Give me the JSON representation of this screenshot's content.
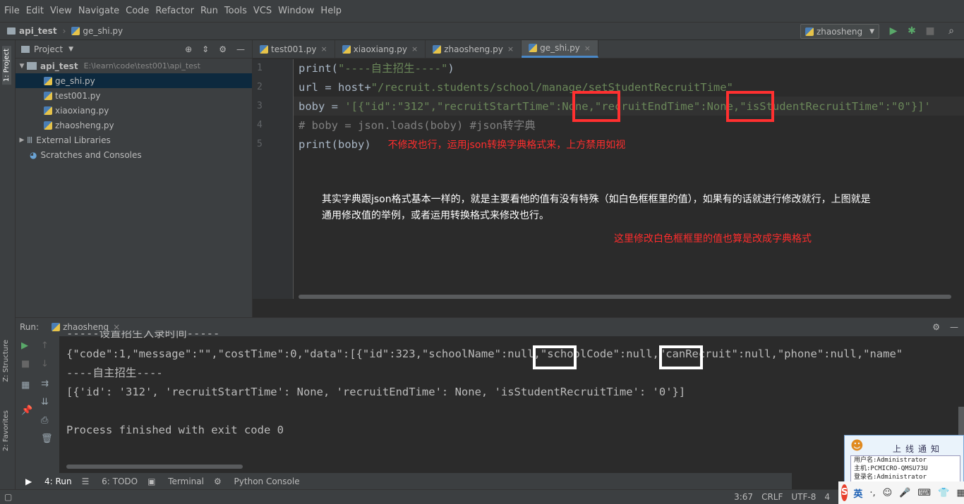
{
  "menu": [
    "File",
    "Edit",
    "View",
    "Navigate",
    "Code",
    "Refactor",
    "Run",
    "Tools",
    "VCS",
    "Window",
    "Help"
  ],
  "breadcrumb": {
    "project": "api_test",
    "file": "ge_shi.py"
  },
  "run_config": "zhaosheng",
  "project_panel": {
    "title": "Project",
    "root": {
      "name": "api_test",
      "path": "E:\\learn\\code\\test001\\api_test"
    },
    "files": [
      "ge_shi.py",
      "test001.py",
      "xiaoxiang.py",
      "zhaosheng.py"
    ],
    "external": "External Libraries",
    "scratches": "Scratches and Consoles"
  },
  "left_tabs": {
    "project": "1: Project",
    "structure": "Z: Structure",
    "favorites": "2: Favorites"
  },
  "editor_tabs": [
    "test001.py",
    "xiaoxiang.py",
    "zhaosheng.py",
    "ge_shi.py"
  ],
  "line_numbers": [
    "1",
    "2",
    "3",
    "4",
    "5"
  ],
  "code": {
    "l1_fn": "print(",
    "l1_str": "\"----自主招生----\"",
    "l1_end": ")",
    "l2_a": "url = host+",
    "l2_str": "\"/recruit.students/school/manage/setStudentRecruitTime\"",
    "l3_a": "boby = ",
    "l3_str": "'[{\"id\":\"312\",\"recruitStartTime\":None,\"recruitEndTime\":None,\"isStudentRecruitTime\":\"0\"}]'",
    "l4": "# boby = json.loads(boby) #json转字典",
    "l5": "print(boby)"
  },
  "annotations": {
    "inline": "不修改也行，运用json转换字典格式来，上方禁用如视",
    "para1": "其实字典跟json格式基本一样的，就是主要看他的值有没有特殊（如白色框框里的值），如果有的话就进行修改就行，上图就是",
    "para2": "通用修改值的举例，或者运用转换格式来修改也行。",
    "red_note": "这里修改白色框框里的值也算是改成字典格式"
  },
  "run_panel": {
    "label": "Run:",
    "config": "zhaosheng",
    "lines": [
      "-----设置招生入录时间-----",
      "{\"code\":1,\"message\":\"\",\"costTime\":0,\"data\":[{\"id\":323,\"schoolName\":null,\"schoolCode\":null,\"canRecruit\":null,\"phone\":null,\"name\"",
      "----自主招生----",
      "[{'id': '312', 'recruitStartTime': None, 'recruitEndTime': None, 'isStudentRecruitTime': '0'}]",
      "",
      "Process finished with exit code 0"
    ]
  },
  "bottom_tabs": [
    "4: Run",
    "6: TODO",
    "Terminal",
    "Python Console"
  ],
  "status": {
    "position": "3:67",
    "line_sep": "CRLF",
    "encoding": "UTF-8",
    "indent": "4"
  },
  "popup": {
    "title": "上线通知",
    "user": "用户名:Administrator",
    "host": "主机:PCMICRO-QMSU73U",
    "login": "登录名:Administrator"
  },
  "tray": {
    "ime": "英"
  }
}
